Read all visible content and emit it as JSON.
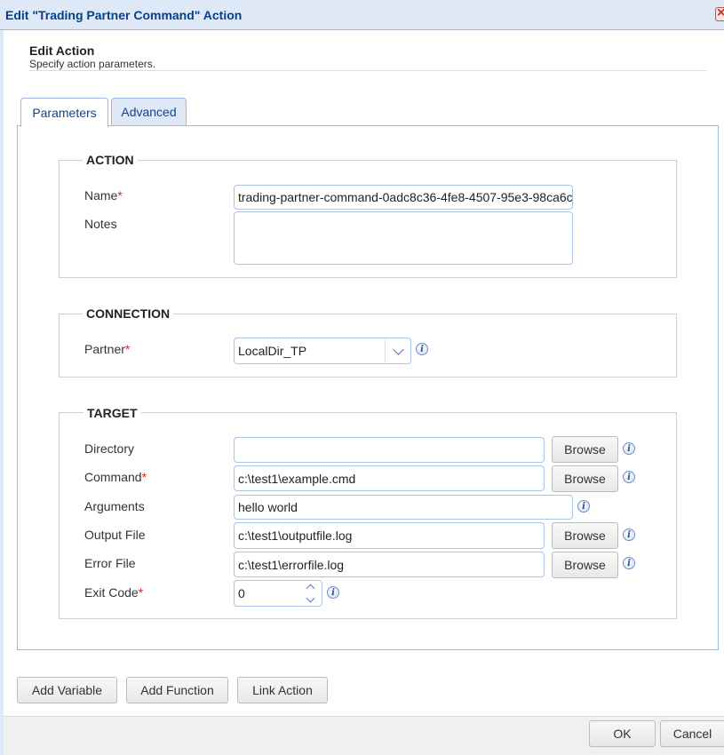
{
  "window": {
    "title": "Edit \"Trading Partner Command\" Action"
  },
  "header": {
    "title": "Edit Action",
    "subtitle": "Specify action parameters."
  },
  "tabs": [
    {
      "label": "Parameters",
      "active": true
    },
    {
      "label": "Advanced",
      "active": false
    }
  ],
  "action": {
    "legend": "ACTION",
    "name_label": "Name",
    "name_value": "trading-partner-command-0adc8c36-4fe8-4507-95e3-98ca6c",
    "notes_label": "Notes",
    "notes_value": ""
  },
  "connection": {
    "legend": "CONNECTION",
    "partner_label": "Partner",
    "partner_value": "LocalDir_TP"
  },
  "target": {
    "legend": "TARGET",
    "directory_label": "Directory",
    "directory_value": "",
    "command_label": "Command",
    "command_value": "c:\\test1\\example.cmd",
    "arguments_label": "Arguments",
    "arguments_value": "hello world",
    "output_label": "Output File",
    "output_value": "c:\\test1\\outputfile.log",
    "error_label": "Error File",
    "error_value": "c:\\test1\\errorfile.log",
    "exit_label": "Exit Code",
    "exit_value": "0",
    "browse_label": "Browse"
  },
  "required_marker": "*",
  "bottom_buttons": {
    "add_variable": "Add Variable",
    "add_function": "Add Function",
    "link_action": "Link Action"
  },
  "footer": {
    "ok": "OK",
    "cancel": "Cancel"
  },
  "icons": {
    "info": "info-icon",
    "close": "close-icon",
    "dropdown": "chevron-down-icon"
  },
  "colors": {
    "required": "#e02020",
    "accent": "#15428b",
    "field_border": "#a8c4e6"
  }
}
